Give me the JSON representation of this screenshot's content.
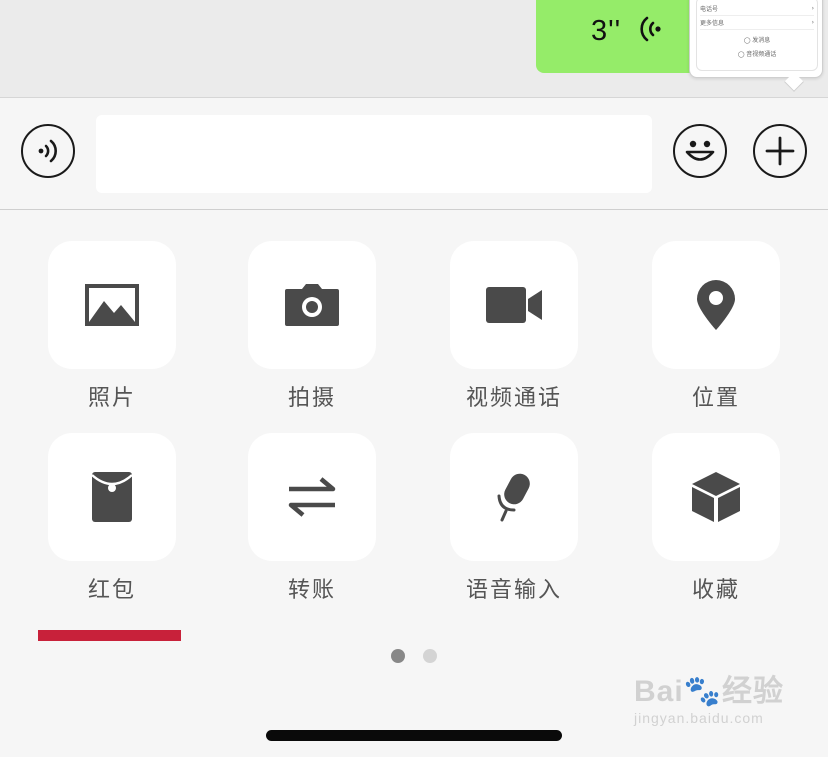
{
  "chat": {
    "voice_message": {
      "duration": "3''"
    },
    "thumbnail": {
      "rows": [
        "电话号",
        "更多信息"
      ],
      "links": [
        "◯ 发消息",
        "◯ 音视频通话"
      ]
    }
  },
  "input_bar": {
    "voice_toggle_icon": "voice-mode-icon",
    "text_value": "",
    "emoji_icon": "smiley-face-icon",
    "more_icon": "plus-circle-icon"
  },
  "panel": {
    "items": [
      {
        "label": "照片",
        "icon": "photo-icon"
      },
      {
        "label": "拍摄",
        "icon": "camera-icon"
      },
      {
        "label": "视频通话",
        "icon": "video-call-icon"
      },
      {
        "label": "位置",
        "icon": "location-pin-icon"
      },
      {
        "label": "红包",
        "icon": "red-packet-icon"
      },
      {
        "label": "转账",
        "icon": "transfer-arrows-icon"
      },
      {
        "label": "语音输入",
        "icon": "microphone-icon"
      },
      {
        "label": "收藏",
        "icon": "favorites-box-icon"
      }
    ],
    "pager": {
      "total": 2,
      "active": 1
    }
  },
  "watermark": {
    "brand_left": "Bai",
    "brand_right": "经验",
    "url": "jingyan.baidu.com"
  },
  "colors": {
    "voice_bubble": "#95ec69",
    "highlight_underline": "#c8213a",
    "tile_bg": "#ffffff",
    "icon_gray": "#4a4a4a"
  }
}
